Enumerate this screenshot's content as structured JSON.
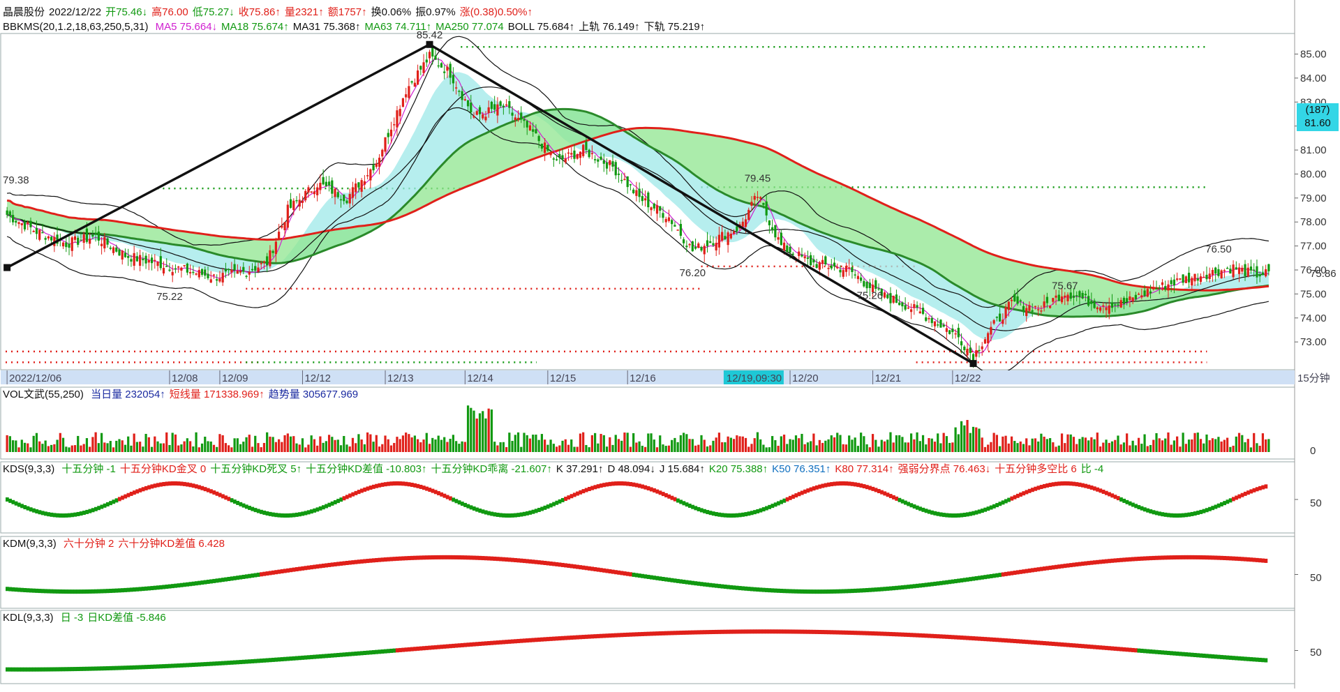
{
  "header": {
    "stock_name": "晶晨股份",
    "date": "2022/12/22",
    "open_label": "开",
    "open": "75.46↓",
    "high_label": "高",
    "high": "76.00",
    "low_label": "低",
    "low": "75.27↓",
    "close_label": "收",
    "close": "75.86↑",
    "vol_label": "量",
    "vol": "2321↑",
    "amt_label": "额",
    "amt": "1757↑",
    "turnover_label": "换",
    "turnover": "0.06%",
    "amp_label": "振",
    "amp": "0.97%",
    "chg_label": "涨",
    "chg": "(0.38)0.50%↑"
  },
  "main_indicator": {
    "name": "BBKMS(20,1.2,18,63,250,5,31)",
    "items": [
      {
        "label": "MA5 75.664↓",
        "color": "#d020d0"
      },
      {
        "label": "MA18 75.674↑",
        "color": "#119911"
      },
      {
        "label": "MA31 75.368↑",
        "color": "#111111"
      },
      {
        "label": "MA63 74.711↑",
        "color": "#119911"
      },
      {
        "label": "MA250 77.074",
        "color": "#119911"
      },
      {
        "label": "BOLL 75.684↑",
        "color": "#111111"
      },
      {
        "label": "上轨 76.149↑",
        "color": "#111111"
      },
      {
        "label": "下轨 75.219↑",
        "color": "#111111"
      }
    ]
  },
  "cursor_box": {
    "count": "(187)",
    "price": "81.60"
  },
  "last_price_label": "75.86",
  "period_label": "15分钟",
  "cursor_date": "12/19,09:30",
  "vol_panel": {
    "name": "VOL文武(55,250)",
    "items": [
      {
        "label": "当日量 232054↑",
        "color": "#1a2aa0"
      },
      {
        "label": "短线量 171338.969↑",
        "color": "#e0201a"
      },
      {
        "label": "趋势量 305677.969",
        "color": "#1a2aa0"
      }
    ],
    "axis_label": "0"
  },
  "kds_panel": {
    "name": "KDS(9,3,3)",
    "items": [
      {
        "label": "十五分钟 -1",
        "color": "#119911"
      },
      {
        "label": "十五分钟KD金叉 0",
        "color": "#e0201a"
      },
      {
        "label": "十五分钟KD死叉 5↑",
        "color": "#119911"
      },
      {
        "label": "十五分钟KD差值 -10.803↑",
        "color": "#119911"
      },
      {
        "label": "十五分钟KD乖离 -21.607↑",
        "color": "#119911"
      },
      {
        "label": "K 37.291↑",
        "color": "#111111"
      },
      {
        "label": "D 48.094↓",
        "color": "#111111"
      },
      {
        "label": "J 15.684↑",
        "color": "#111111"
      },
      {
        "label": "K20 75.388↑",
        "color": "#119911"
      },
      {
        "label": "K50 76.351↑",
        "color": "#1070c0"
      },
      {
        "label": "K80 77.314↑",
        "color": "#e0201a"
      },
      {
        "label": "强弱分界点 76.463↓",
        "color": "#e0201a"
      },
      {
        "label": "十五分钟多空比 6",
        "color": "#e0201a"
      },
      {
        "label": "比 -4",
        "color": "#119911"
      }
    ],
    "axis_label": "50"
  },
  "kdm_panel": {
    "name": "KDM(9,3,3)",
    "items": [
      {
        "label": "六十分钟 2",
        "color": "#e0201a"
      },
      {
        "label": "六十分钟KD差值 6.428",
        "color": "#e0201a"
      }
    ],
    "axis_label": "50"
  },
  "kdl_panel": {
    "name": "KDL(9,3,3)",
    "items": [
      {
        "label": "日 -3",
        "color": "#119911"
      },
      {
        "label": "日KD差值 -5.846",
        "color": "#119911"
      }
    ],
    "axis_label": "50"
  },
  "chart_data": {
    "type": "candlestick",
    "x_dates": [
      "2022/12/06",
      "12/08",
      "12/09",
      "12/12",
      "12/13",
      "12/14",
      "12/15",
      "12/16",
      "12/20",
      "12/21",
      "12/22"
    ],
    "ylim": [
      71.9,
      85.8
    ],
    "y_ticks": [
      73.0,
      74.0,
      75.0,
      76.0,
      77.0,
      78.0,
      79.0,
      80.0,
      81.0,
      82.0,
      83.0,
      84.0,
      85.0
    ],
    "peak_labels": [
      {
        "bar": 3,
        "price": 79.38,
        "text": "79.38",
        "color": "#e0201a"
      },
      {
        "bar": 55,
        "price": 75.22,
        "text": "75.22",
        "color": "#119911"
      },
      {
        "bar": 143,
        "price": 85.42,
        "text": "85.42",
        "color": "#e0201a"
      },
      {
        "bar": 232,
        "price": 76.2,
        "text": "76.20",
        "color": "#119911"
      },
      {
        "bar": 254,
        "price": 79.45,
        "text": "79.45",
        "color": "#e0201a"
      },
      {
        "bar": 292,
        "price": 75.26,
        "text": "75.26",
        "color": "#111111"
      },
      {
        "bar": 358,
        "price": 75.67,
        "text": "75.67",
        "color": "#111111"
      },
      {
        "bar": 410,
        "price": 76.5,
        "text": "76.50",
        "color": "#e0201a"
      }
    ],
    "zigzag": [
      [
        0,
        76.1
      ],
      [
        143,
        85.4
      ],
      [
        327,
        72.1
      ]
    ],
    "resistance_levels": [
      {
        "price": 85.3,
        "color": "#119911",
        "from": 0.36,
        "to": 0.95
      },
      {
        "price": 79.45,
        "color": "#119911",
        "from": 0.55,
        "to": 0.95
      },
      {
        "price": 79.4,
        "color": "#119911",
        "from": 0.12,
        "to": 0.36
      },
      {
        "price": 76.15,
        "color": "#e0201a",
        "from": 0.55,
        "to": 0.72
      },
      {
        "price": 75.22,
        "color": "#e0201a",
        "from": 0.19,
        "to": 0.55
      },
      {
        "price": 72.6,
        "color": "#e0201a",
        "from": 0.0,
        "to": 0.95
      },
      {
        "price": 72.15,
        "color": "#e0201a",
        "from": 0.0,
        "to": 0.2
      },
      {
        "price": 72.15,
        "color": "#119911",
        "from": 0.19,
        "to": 0.42
      },
      {
        "price": 72.15,
        "color": "#e0201a",
        "from": 0.72,
        "to": 0.95
      }
    ],
    "close_path": [
      [
        0,
        78.3
      ],
      [
        10,
        77.6
      ],
      [
        20,
        77.1
      ],
      [
        30,
        77.4
      ],
      [
        40,
        76.6
      ],
      [
        50,
        76.3
      ],
      [
        60,
        76.0
      ],
      [
        70,
        75.7
      ],
      [
        80,
        75.9
      ],
      [
        88,
        76.3
      ],
      [
        95,
        78.5
      ],
      [
        105,
        79.6
      ],
      [
        115,
        79.0
      ],
      [
        125,
        80.5
      ],
      [
        135,
        83.5
      ],
      [
        143,
        84.9
      ],
      [
        150,
        84.2
      ],
      [
        158,
        82.4
      ],
      [
        168,
        82.8
      ],
      [
        178,
        81.7
      ],
      [
        186,
        80.5
      ],
      [
        195,
        81.0
      ],
      [
        205,
        80.3
      ],
      [
        214,
        79.0
      ],
      [
        224,
        78.2
      ],
      [
        232,
        76.8
      ],
      [
        240,
        77.3
      ],
      [
        248,
        77.8
      ],
      [
        254,
        79.1
      ],
      [
        262,
        77.0
      ],
      [
        272,
        76.3
      ],
      [
        285,
        76.0
      ],
      [
        295,
        75.0
      ],
      [
        305,
        74.5
      ],
      [
        315,
        73.8
      ],
      [
        322,
        73.2
      ],
      [
        327,
        72.4
      ],
      [
        332,
        73.4
      ],
      [
        340,
        74.6
      ],
      [
        350,
        74.4
      ],
      [
        358,
        75.1
      ],
      [
        368,
        74.6
      ],
      [
        378,
        74.6
      ],
      [
        388,
        75.2
      ],
      [
        398,
        75.6
      ],
      [
        408,
        75.9
      ],
      [
        415,
        76.1
      ],
      [
        422,
        75.8
      ],
      [
        427,
        75.86
      ]
    ]
  }
}
